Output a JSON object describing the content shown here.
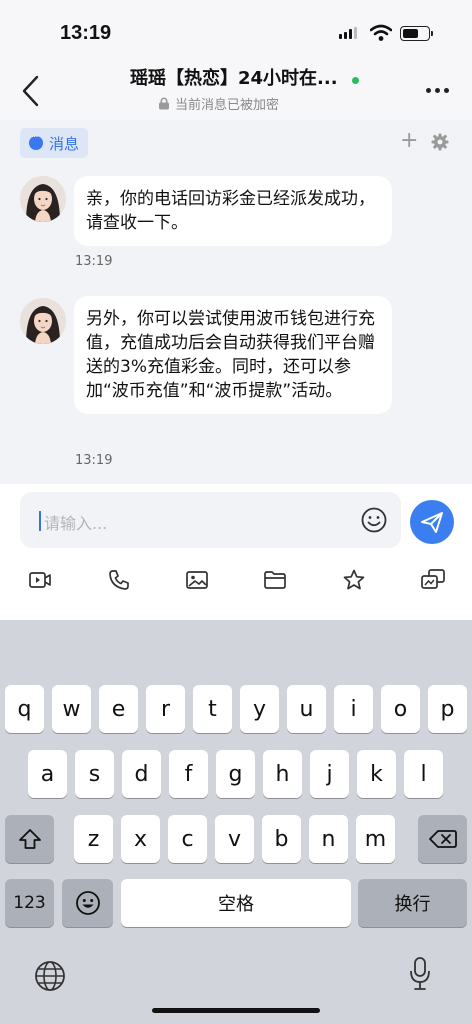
{
  "status_bar": {
    "time": "13:19"
  },
  "header": {
    "title": "瑶瑶【热恋】24小时在...",
    "subtitle": "当前消息已被加密"
  },
  "tabs": {
    "messages_label": "消息",
    "add_label": "+"
  },
  "messages": [
    {
      "text": "亲，你的电话回访彩金已经派发成功，请查收一下。",
      "time": "13:19"
    },
    {
      "text": "另外，你可以尝试使用波币钱包进行充值，充值成功后会自动获得我们平台赠送的3%充值彩金。同时，还可以参加“波币充值”和“波币提款”活动。",
      "time": "13:19"
    }
  ],
  "composer": {
    "placeholder": "请输入..."
  },
  "toolbar_icons": [
    "video-icon",
    "phone-icon",
    "image-icon",
    "folder-icon",
    "star-icon",
    "screenshot-icon"
  ],
  "keyboard": {
    "row1": [
      "q",
      "w",
      "e",
      "r",
      "t",
      "y",
      "u",
      "i",
      "o",
      "p"
    ],
    "row2": [
      "a",
      "s",
      "d",
      "f",
      "g",
      "h",
      "j",
      "k",
      "l"
    ],
    "row3": [
      "z",
      "x",
      "c",
      "v",
      "b",
      "n",
      "m"
    ],
    "numbers_key": "123",
    "space_label": "空格",
    "return_label": "换行"
  },
  "colors": {
    "accent": "#3a7ef0",
    "online": "#22c05a",
    "tab_bg": "#dce6f7"
  }
}
